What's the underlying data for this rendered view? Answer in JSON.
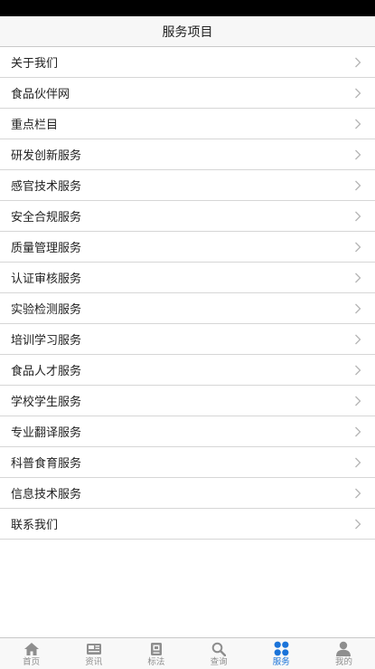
{
  "header": {
    "title": "服务项目"
  },
  "menu": {
    "items": [
      {
        "label": "关于我们"
      },
      {
        "label": "食品伙伴网"
      },
      {
        "label": "重点栏目"
      },
      {
        "label": "研发创新服务"
      },
      {
        "label": "感官技术服务"
      },
      {
        "label": "安全合规服务"
      },
      {
        "label": "质量管理服务"
      },
      {
        "label": "认证审核服务"
      },
      {
        "label": "实验检测服务"
      },
      {
        "label": "培训学习服务"
      },
      {
        "label": "食品人才服务"
      },
      {
        "label": "学校学生服务"
      },
      {
        "label": "专业翻译服务"
      },
      {
        "label": "科普食育服务"
      },
      {
        "label": "信息技术服务"
      },
      {
        "label": "联系我们"
      }
    ]
  },
  "tabbar": {
    "active_color": "#1a73d9",
    "inactive_color": "#8e8e8e",
    "tabs": [
      {
        "label": "首页",
        "icon": "home-icon"
      },
      {
        "label": "资讯",
        "icon": "news-icon"
      },
      {
        "label": "标法",
        "icon": "standard-book-icon"
      },
      {
        "label": "查询",
        "icon": "search-icon"
      },
      {
        "label": "服务",
        "icon": "grid-icon",
        "active": true
      },
      {
        "label": "我的",
        "icon": "user-icon"
      }
    ]
  }
}
